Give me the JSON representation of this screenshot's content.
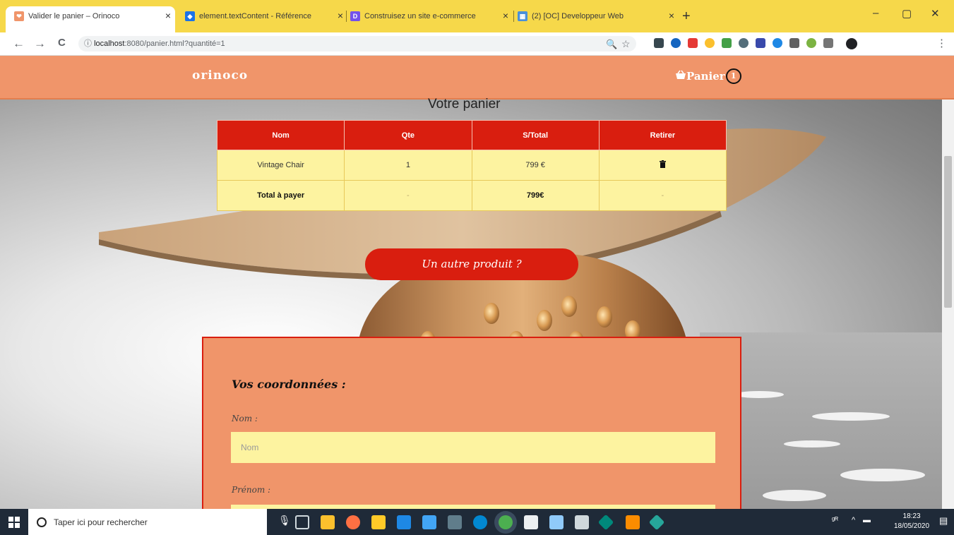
{
  "browser": {
    "tabs": [
      {
        "title": "Valider le panier – Orinoco",
        "active": true,
        "favicon_color": "#f0956a"
      },
      {
        "title": "element.textContent - Référence",
        "active": false,
        "favicon_color": "#1a73e8"
      },
      {
        "title": "Construisez un site e-commerce",
        "active": false,
        "favicon_color": "#7451eb"
      },
      {
        "title": "(2) [OC] Developpeur Web",
        "active": false,
        "favicon_color": "#4a90d9"
      }
    ],
    "new_tab": "+",
    "window_controls": {
      "minimize": "–",
      "maximize": "▢",
      "close": "✕"
    },
    "nav": {
      "back": "←",
      "forward": "→",
      "reload": "C"
    },
    "address": {
      "host": "localhost",
      "rest": ":8080/panier.html?quantité=1"
    }
  },
  "site": {
    "brand": "orinoco",
    "cart_label": "Panier",
    "cart_count": "1",
    "page_title": "Votre panier"
  },
  "cart_table": {
    "headers": [
      "Nom",
      "Qte",
      "S/Total",
      "Retirer"
    ],
    "rows": [
      {
        "name": "Vintage Chair",
        "qty": "1",
        "subtotal": "799 €",
        "remove_icon": "trash-icon"
      }
    ],
    "total_row": {
      "label": "Total à payer",
      "qty": "-",
      "total": "799€",
      "remove": "-"
    }
  },
  "other_product_button": "Un autre produit ?",
  "form": {
    "heading": "Vos coordonnées :",
    "fields": [
      {
        "label": "Nom :",
        "placeholder": "Nom"
      },
      {
        "label": "Prénom :",
        "placeholder": ""
      }
    ]
  },
  "taskbar": {
    "search_placeholder": "Taper ici pour rechercher",
    "time": "18:23",
    "date": "18/05/2020"
  }
}
